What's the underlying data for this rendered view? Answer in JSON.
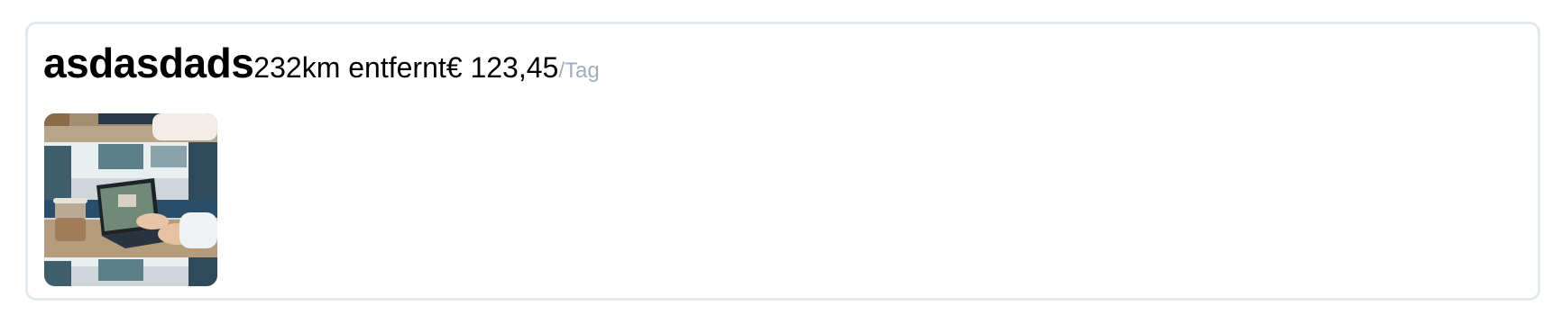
{
  "listing": {
    "title": "asdasdads",
    "distance": "232km entfernt",
    "price": "€ 123,45",
    "per_unit": "/Tag",
    "image": {
      "icon": "laptop-cafe-photo"
    }
  },
  "colors": {
    "border": "#e2e8f0",
    "muted_text": "#a0aec0",
    "text": "#000000"
  }
}
